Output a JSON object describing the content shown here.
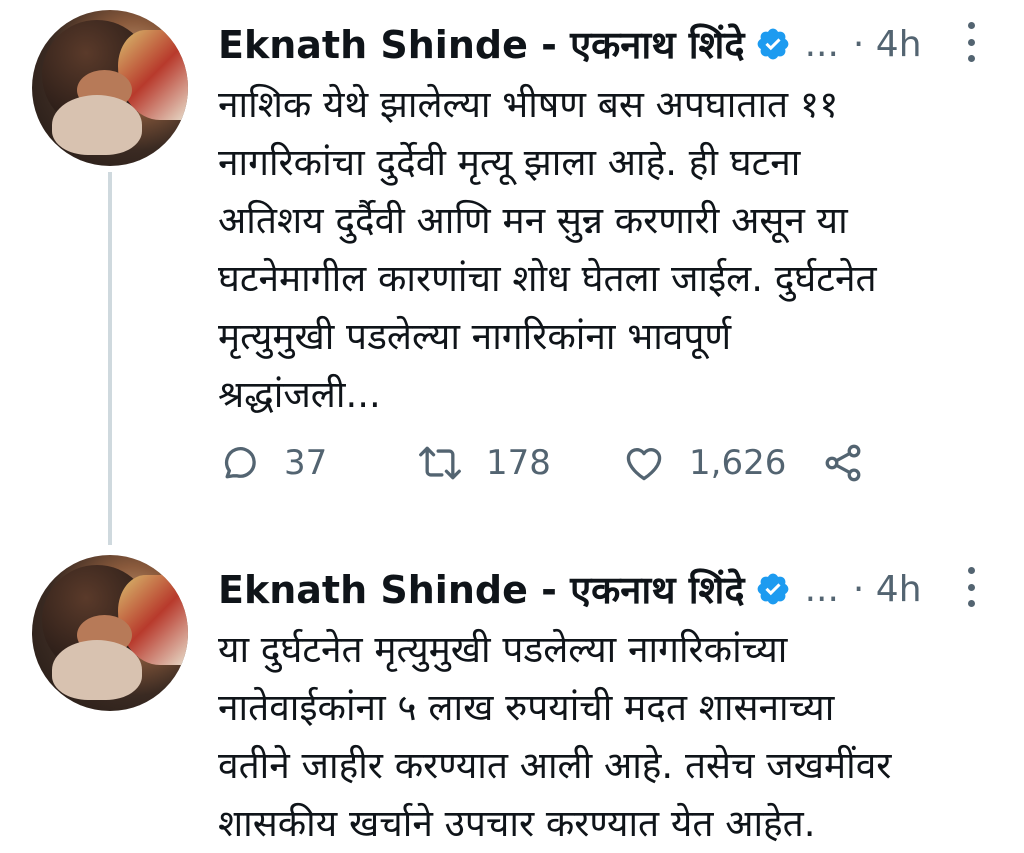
{
  "tweets": [
    {
      "author_name": "Eknath Shinde - एकनाथ शिंदे",
      "ellipsis": "...",
      "time": "· 4h",
      "text_lines": [
        "नाशिक येथे झालेल्या भीषण बस अपघातात ११",
        "नागरिकांचा दुर्देवी मृत्यू झाला आहे. ही घटना",
        "अतिशय दुर्दैवी आणि मन सुन्न करणारी असून या",
        "घटनेमागील कारणांचा शोध घेतला जाईल. दुर्घटनेत",
        "मृत्युमुखी पडलेल्या नागरिकांना भावपूर्ण",
        "श्रद्धांजली..."
      ],
      "actions": {
        "reply_count": "37",
        "retweet_count": "178",
        "like_count": "1,626"
      }
    },
    {
      "author_name": "Eknath Shinde - एकनाथ शिंदे",
      "ellipsis": "...",
      "time": "· 4h",
      "text_lines": [
        "या दुर्घटनेत मृत्युमुखी पडलेल्या नागरिकांच्या",
        "नातेवाईकांना ५ लाख रुपयांची मदत शासनाच्या",
        "वतीने जाहीर करण्यात आली आहे. तसेच जखमींवर",
        "शासकीय खर्चाने उपचार करण्यात येत आहेत."
      ]
    }
  ],
  "icons": {
    "verified": "verified-badge-icon",
    "reply": "reply-icon",
    "retweet": "retweet-icon",
    "like": "heart-icon",
    "share": "share-icon",
    "more": "more-vertical-icon"
  },
  "colors": {
    "verified_blue": "#1d9bf0",
    "secondary_text": "#536471",
    "thread_line": "#cfd9de"
  }
}
